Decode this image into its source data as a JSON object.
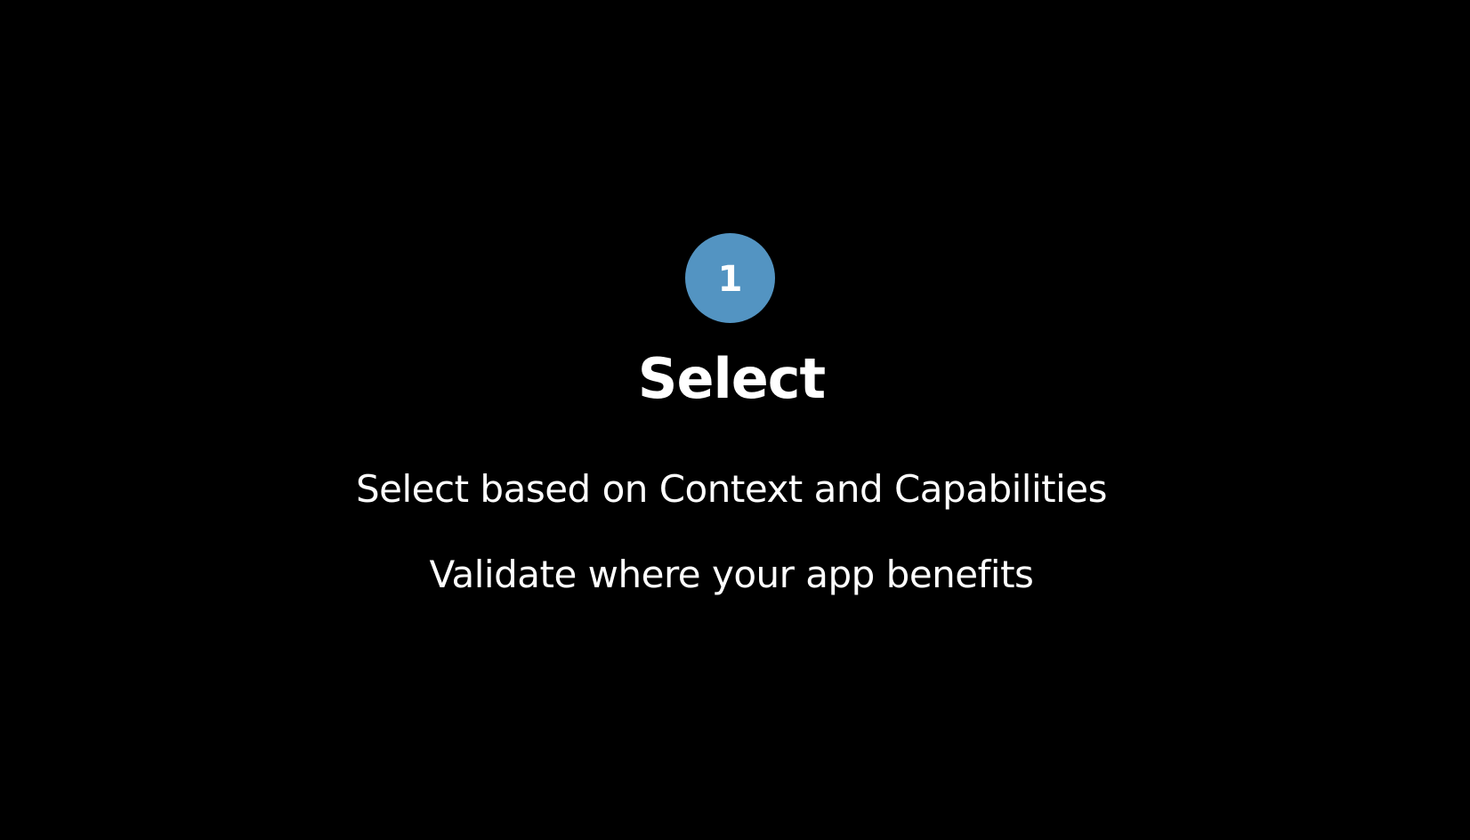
{
  "slide": {
    "step_number": "1",
    "title": "Select",
    "lines": [
      "Select based on Context and Capabilities",
      "Validate where your app benefits"
    ]
  },
  "colors": {
    "background": "#000000",
    "badge": "#5394c2",
    "text": "#ffffff"
  }
}
